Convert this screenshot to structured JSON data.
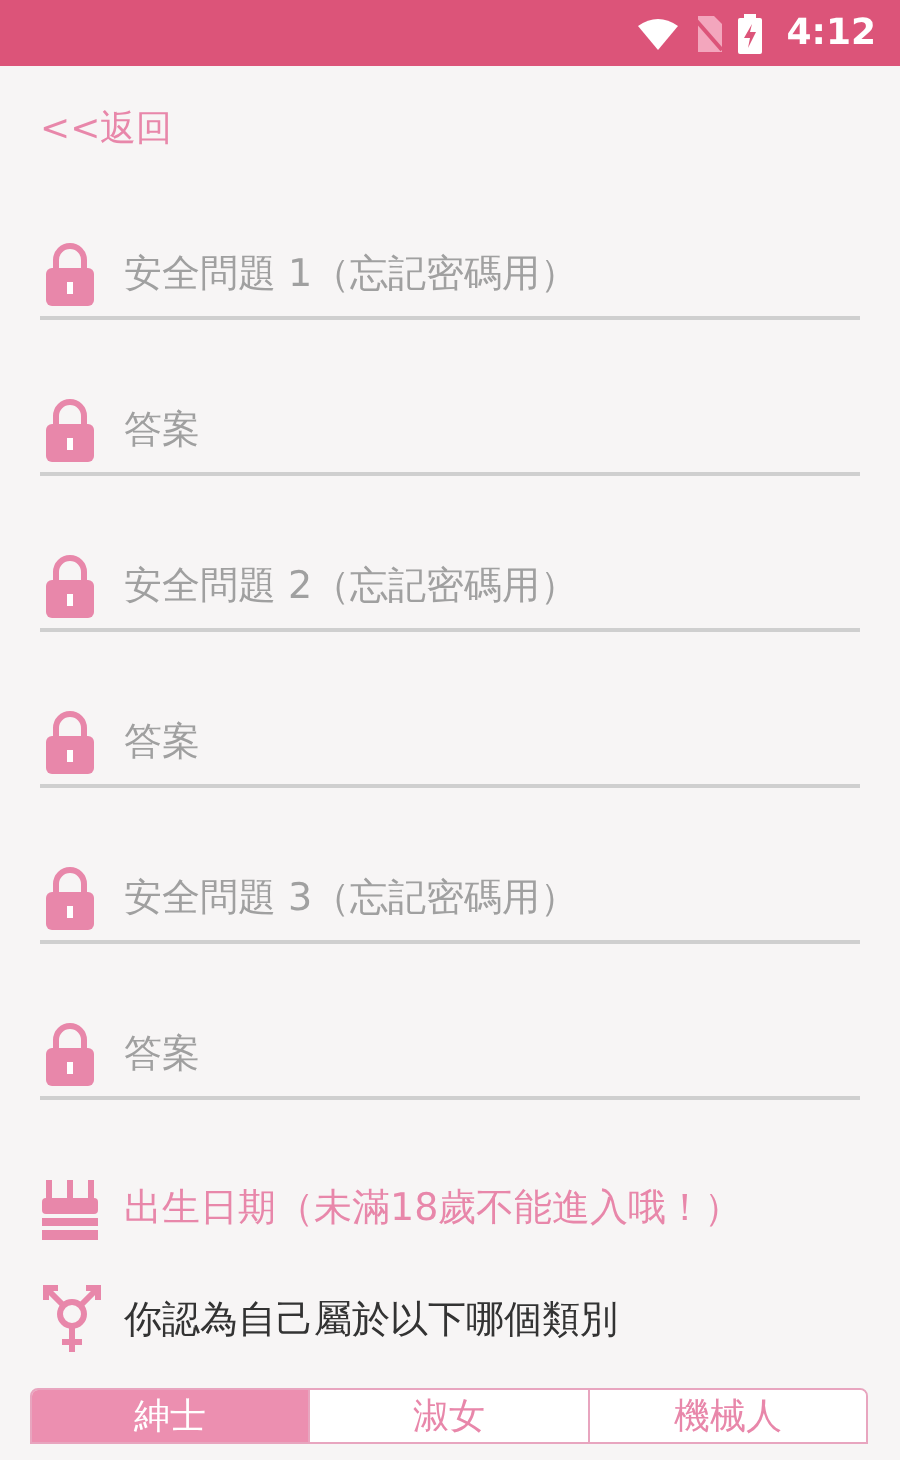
{
  "status_bar": {
    "time": "4:12"
  },
  "back_link": "<<返回",
  "fields": [
    {
      "placeholder": "安全問題 1（忘記密碼用）"
    },
    {
      "placeholder": "答案"
    },
    {
      "placeholder": "安全問題 2（忘記密碼用）"
    },
    {
      "placeholder": "答案"
    },
    {
      "placeholder": "安全問題 3（忘記密碼用）"
    },
    {
      "placeholder": "答案"
    }
  ],
  "birthday": "出生日期（未滿18歲不能進入哦！）",
  "gender_prompt": "你認為自己屬於以下哪個類別",
  "gender_options": [
    {
      "label": "紳士",
      "selected": true
    },
    {
      "label": "淑女",
      "selected": false
    },
    {
      "label": "機械人",
      "selected": false
    }
  ]
}
